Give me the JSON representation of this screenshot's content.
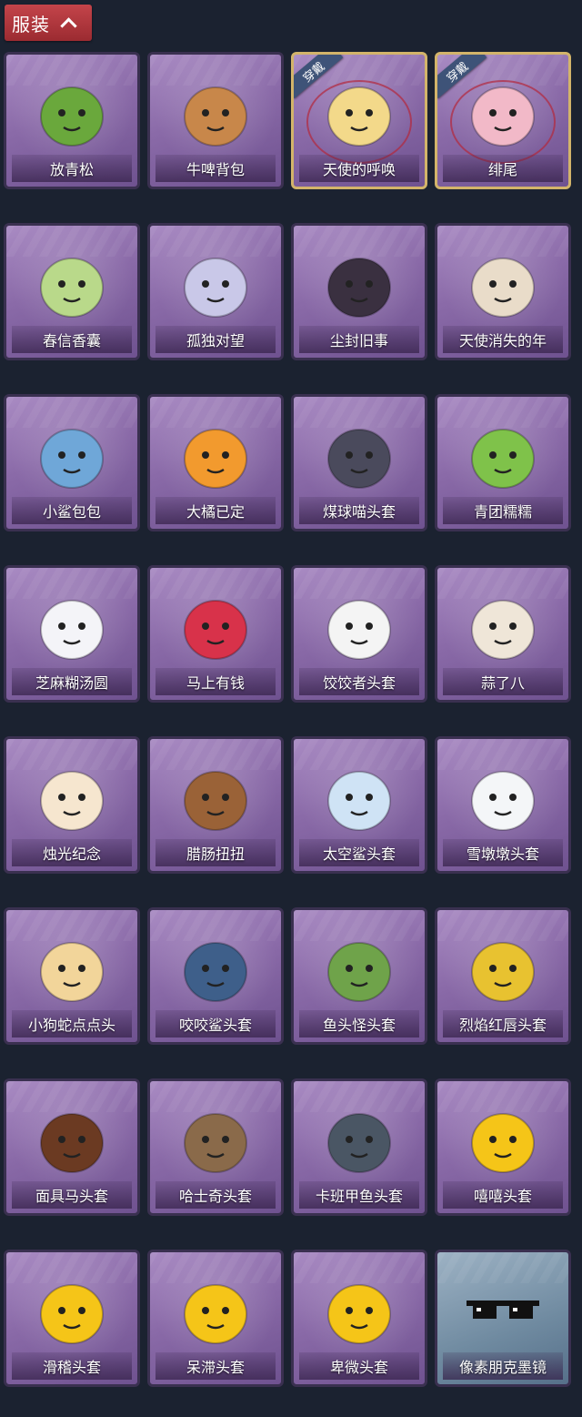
{
  "header": {
    "label": "服装"
  },
  "colors": {
    "header_red": "#b5373d",
    "card_purple": "#8a6aa8",
    "worn_gold": "#d3b46a"
  },
  "items": [
    {
      "label": "放青松",
      "icon": "bonsai-icon",
      "color": "#6aa83c"
    },
    {
      "label": "牛啤背包",
      "icon": "cow-barrel-icon",
      "color": "#c8874a"
    },
    {
      "label": "天使的呼唤",
      "icon": "angel-icon",
      "color": "#f3d98a",
      "badge": "穿戴"
    },
    {
      "label": "绯尾",
      "icon": "fox-girl-icon",
      "color": "#f2b9c8",
      "badge": "穿戴"
    },
    {
      "label": "春信香囊",
      "icon": "sachet-icon",
      "color": "#b9d98a"
    },
    {
      "label": "孤独对望",
      "icon": "doll-icon",
      "color": "#c9c8e8"
    },
    {
      "label": "尘封旧事",
      "icon": "prince-doll-icon",
      "color": "#3a3040"
    },
    {
      "label": "天使消失的年",
      "icon": "angel-doll-icon",
      "color": "#e9dcc9"
    },
    {
      "label": "小鲨包包",
      "icon": "shark-bag-icon",
      "color": "#6fa7d8"
    },
    {
      "label": "大橘已定",
      "icon": "orange-icon",
      "color": "#f29a2e"
    },
    {
      "label": "煤球喵头套",
      "icon": "cat-head-icon",
      "color": "#4a4a5c"
    },
    {
      "label": "青团糯糯",
      "icon": "green-dumpling-icon",
      "color": "#7fc24a"
    },
    {
      "label": "芝麻糊汤圆",
      "icon": "rice-ball-icon",
      "color": "#f4f4f8"
    },
    {
      "label": "马上有钱",
      "icon": "horse-head-icon",
      "color": "#d8324a"
    },
    {
      "label": "饺饺者头套",
      "icon": "dumpling-head-icon",
      "color": "#f4f4f4"
    },
    {
      "label": "蒜了八",
      "icon": "garlic-icon",
      "color": "#efe6d8"
    },
    {
      "label": "烛光纪念",
      "icon": "candle-icon",
      "color": "#f6e6cf"
    },
    {
      "label": "腊肠扭扭",
      "icon": "dog-head-icon",
      "color": "#9a6237"
    },
    {
      "label": "太空鲨头套",
      "icon": "space-shark-icon",
      "color": "#cfe3f5"
    },
    {
      "label": "雪墩墩头套",
      "icon": "snowman-icon",
      "color": "#f4f6f8"
    },
    {
      "label": "小狗蛇点点头",
      "icon": "snake-icon",
      "color": "#f2d59a"
    },
    {
      "label": "咬咬鲨头套",
      "icon": "shark-head-icon",
      "color": "#3e5f8a"
    },
    {
      "label": "鱼头怪头套",
      "icon": "fish-head-icon",
      "color": "#6fa34a"
    },
    {
      "label": "烈焰红唇头套",
      "icon": "yellow-mouse-icon",
      "color": "#e8c230"
    },
    {
      "label": "面具马头套",
      "icon": "horse-mask-icon",
      "color": "#6b3a22"
    },
    {
      "label": "哈士奇头套",
      "icon": "husky-icon",
      "color": "#8a6a4a"
    },
    {
      "label": "卡班甲鱼头套",
      "icon": "turtle-head-icon",
      "color": "#4a5664"
    },
    {
      "label": "嘻嘻头套",
      "icon": "grin-emoji-icon",
      "color": "#f5c518"
    },
    {
      "label": "滑稽头套",
      "icon": "smirk-emoji-icon",
      "color": "#f5c518"
    },
    {
      "label": "呆滞头套",
      "icon": "stare-emoji-icon",
      "color": "#f5c518"
    },
    {
      "label": "卑微头套",
      "icon": "shy-emoji-icon",
      "color": "#f5c518"
    },
    {
      "label": "像素朋克墨镜",
      "icon": "pixel-sunglasses-icon",
      "color": "#111111",
      "special": true
    }
  ]
}
